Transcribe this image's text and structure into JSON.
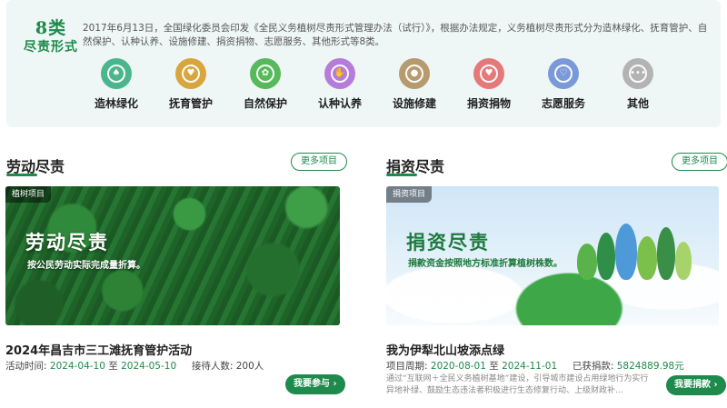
{
  "banner": {
    "title_big": "8类",
    "title_sub": "尽责形式",
    "description": "2017年6月13日，全国绿化委员会印发《全民义务植树尽责形式管理办法（试行）》，根据办法规定，义务植树尽责形式分为造林绿化、抚育管护、自然保护、认种认养、设施修建、捐资捐物、志愿服务、其他形式等8类。",
    "categories": [
      {
        "label": "造林绿化",
        "icon": "tree-icon",
        "color": "#4bb68e",
        "glyph": "♠"
      },
      {
        "label": "抚育管护",
        "icon": "shield-icon",
        "color": "#d9a53e",
        "glyph": "♥"
      },
      {
        "label": "自然保护",
        "icon": "leaf-icon",
        "color": "#57b95b",
        "glyph": "✿"
      },
      {
        "label": "认种认养",
        "icon": "hand-seed-icon",
        "color": "#b57cda",
        "glyph": "✋"
      },
      {
        "label": "设施修建",
        "icon": "location-pin-icon",
        "color": "#b79a6e",
        "glyph": "●"
      },
      {
        "label": "捐资捐物",
        "icon": "hand-heart-icon",
        "color": "#e4797a",
        "glyph": "♥"
      },
      {
        "label": "志愿服务",
        "icon": "heart-icon",
        "color": "#7a99d8",
        "glyph": "♡"
      },
      {
        "label": "其他",
        "icon": "more-dots-icon",
        "color": "#b3b3b3",
        "glyph": "•••"
      }
    ]
  },
  "labor": {
    "section_title": "劳动尽责",
    "more_label": "更多项目",
    "tag": "植树项目",
    "image_title": "劳动尽责",
    "image_subtitle": "按公民劳动实际完成量折算。",
    "project_title": "2024年昌吉市三工滩抚育管护活动",
    "time_label": "活动时间:",
    "start_date": "2024-04-10",
    "to_label": "至",
    "end_date": "2024-05-10",
    "capacity_label": "接待人数:",
    "capacity_value": "200人",
    "action_label": "我要参与",
    "arrow": "›"
  },
  "donation": {
    "section_title": "捐资尽责",
    "more_label": "更多项目",
    "tag": "捐资项目",
    "image_title": "捐资尽责",
    "image_subtitle": "捐款资金按照地方标准折算植树株数。",
    "project_title": "我为伊犁北山坡添点绿",
    "period_label": "项目周期:",
    "start_date": "2020-08-01",
    "to_label": "至",
    "end_date": "2024-11-01",
    "raised_label": "已获捐款:",
    "raised_value": "5824889.98元",
    "description": "通过“互联网＋全民义务植树基地”建设，引导城市建设占用绿地行为实行异地补绿、鼓励生态违法者积极进行生态修复行动、上级财政补...",
    "action_label": "我要捐款",
    "arrow": "›"
  }
}
